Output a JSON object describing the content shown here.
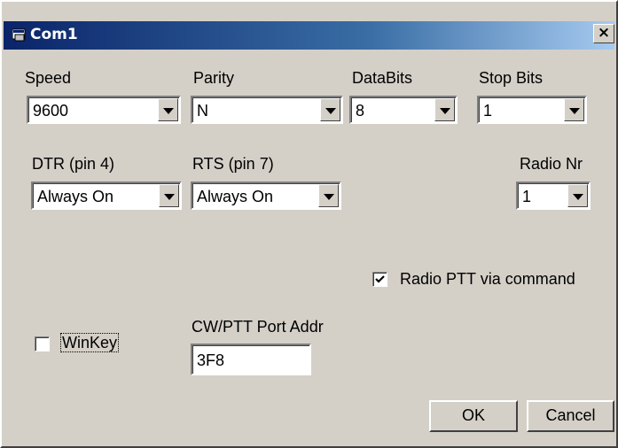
{
  "window": {
    "title": "Com1",
    "title_icon": "window-app-icon",
    "close_label": "×",
    "colors": {
      "face": "#d4d0c8",
      "title_start": "#0a246a",
      "title_end": "#a6caf0"
    }
  },
  "serial": {
    "speed": {
      "label": "Speed",
      "value": "9600"
    },
    "parity": {
      "label": "Parity",
      "value": "N"
    },
    "databits": {
      "label": "DataBits",
      "value": "8"
    },
    "stopbits": {
      "label": "Stop Bits",
      "value": "1"
    }
  },
  "lines": {
    "dtr": {
      "label": "DTR (pin 4)",
      "value": "Always On"
    },
    "rts": {
      "label": "RTS (pin 7)",
      "value": "Always On"
    }
  },
  "radio": {
    "nr_label": "Radio Nr",
    "nr_value": "1",
    "ptt_via_command": {
      "label": "Radio PTT via command",
      "checked": true
    }
  },
  "winkey": {
    "label": "WinKey",
    "checked": false
  },
  "cwptt": {
    "label": "CW/PTT Port Addr",
    "value": "3F8"
  },
  "buttons": {
    "ok": "OK",
    "cancel": "Cancel"
  }
}
